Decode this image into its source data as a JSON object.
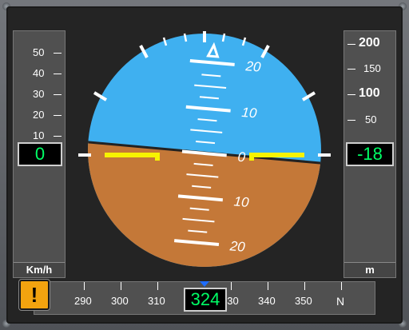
{
  "speed": {
    "ticks": [
      "50",
      "40",
      "30",
      "20",
      "10"
    ],
    "value": "0",
    "unit": "Km/h"
  },
  "altitude": {
    "ticks_major": [
      "200",
      "100"
    ],
    "ticks_minor": [
      "150",
      "50"
    ],
    "value": "-18",
    "unit": "m"
  },
  "attitude": {
    "pitch_labels": [
      "20",
      "10",
      "0",
      "10",
      "20"
    ],
    "sky_color": "#3fb0f0",
    "ground_color": "#c47838",
    "wing_color": "#f7f300"
  },
  "heading": {
    "ticks": [
      "290",
      "300",
      "310",
      "330",
      "340",
      "350",
      "N"
    ],
    "value": "324"
  },
  "warning": {
    "symbol": "!",
    "icon": "warning-icon"
  }
}
